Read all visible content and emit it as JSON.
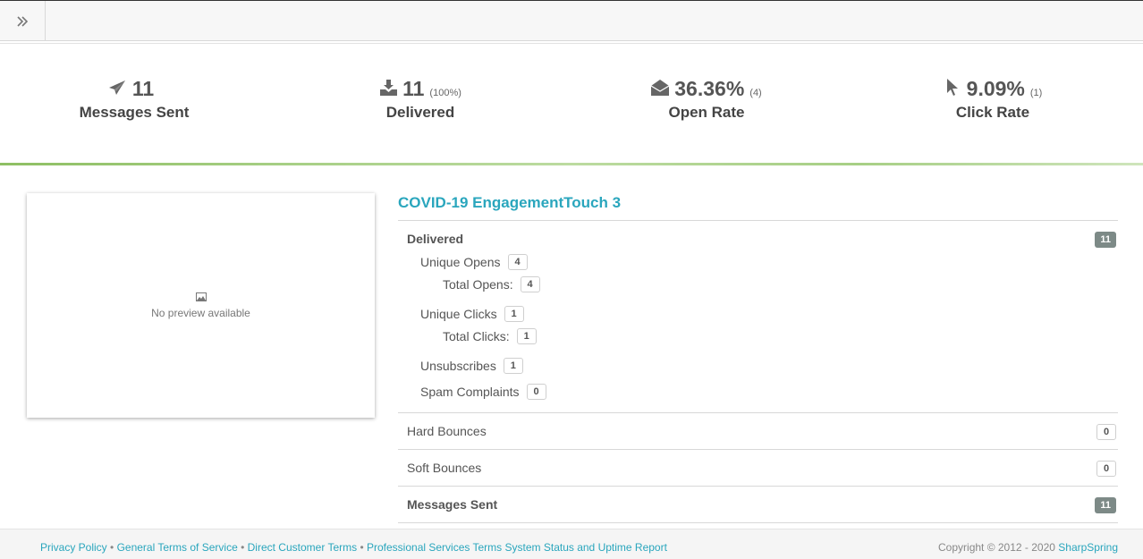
{
  "topbar": {
    "toggle_icon": "double-chevron-right-icon"
  },
  "stats": [
    {
      "icon": "paper-plane-icon",
      "value": "11",
      "sub": "",
      "label": "Messages Sent"
    },
    {
      "icon": "inbox-download-icon",
      "value": "11",
      "sub": "(100%)",
      "label": "Delivered"
    },
    {
      "icon": "open-envelope-icon",
      "value": "36.36%",
      "sub": "(4)",
      "label": "Open Rate"
    },
    {
      "icon": "mouse-pointer-icon",
      "value": "9.09%",
      "sub": "(1)",
      "label": "Click Rate"
    }
  ],
  "preview": {
    "icon": "image-icon",
    "text": "No preview available"
  },
  "details": {
    "title": "COVID-19 EngagementTouch 3",
    "delivered": {
      "label": "Delivered",
      "count": "11"
    },
    "unique_opens": {
      "label": "Unique Opens",
      "count": "4"
    },
    "total_opens": {
      "label": "Total Opens:",
      "count": "4"
    },
    "unique_clicks": {
      "label": "Unique Clicks",
      "count": "1"
    },
    "total_clicks": {
      "label": "Total Clicks:",
      "count": "1"
    },
    "unsubscribes": {
      "label": "Unsubscribes",
      "count": "1"
    },
    "spam": {
      "label": "Spam Complaints",
      "count": "0"
    },
    "hard_bounces": {
      "label": "Hard Bounces",
      "count": "0"
    },
    "soft_bounces": {
      "label": "Soft Bounces",
      "count": "0"
    },
    "messages_sent": {
      "label": "Messages Sent",
      "count": "11"
    }
  },
  "footer": {
    "privacy": "Privacy Policy",
    "sep": "•",
    "general_terms": "General Terms of Service",
    "direct_terms": "Direct Customer Terms",
    "professional_terms": "Professional Services Terms",
    "status": "System Status and Uptime Report",
    "copyright": "Copyright © 2012 - 2020",
    "brand": "SharpSpring"
  },
  "colors": {
    "accent": "#2aa6bd",
    "badge_dark": "#7d8a87",
    "progress_green": "#8ebf63"
  }
}
